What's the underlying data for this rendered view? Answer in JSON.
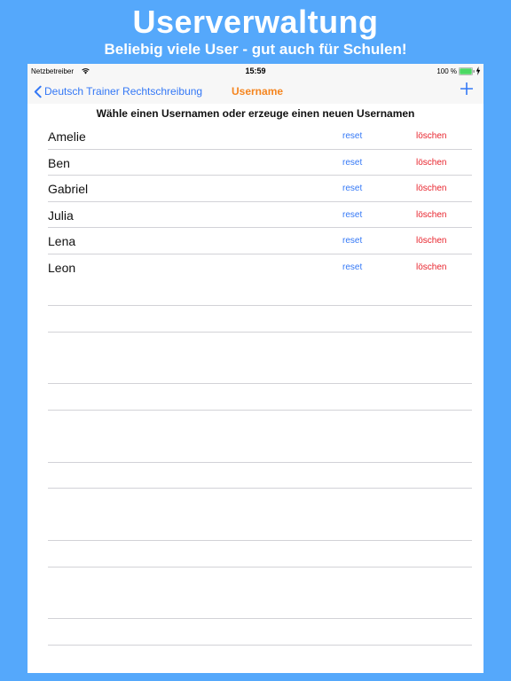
{
  "promo": {
    "title": "Userverwaltung",
    "subtitle": "Beliebig viele User - gut auch für Schulen!"
  },
  "statusbar": {
    "carrier": "Netzbetreiber",
    "time": "15:59",
    "battery": "100 %"
  },
  "navbar": {
    "back_label": "Deutsch Trainer Rechtschreibung",
    "title": "Username"
  },
  "instruction": "Wähle einen Usernamen oder erzeuge einen neuen Usernamen",
  "users": [
    {
      "name": "Amelie",
      "reset": "reset",
      "delete": "löschen"
    },
    {
      "name": "Ben",
      "reset": "reset",
      "delete": "löschen"
    },
    {
      "name": "Gabriel",
      "reset": "reset",
      "delete": "löschen"
    },
    {
      "name": "Julia",
      "reset": "reset",
      "delete": "löschen"
    },
    {
      "name": "Lena",
      "reset": "reset",
      "delete": "löschen"
    },
    {
      "name": "Leon",
      "reset": "reset",
      "delete": "löschen"
    }
  ],
  "colors": {
    "background": "#55a8fb",
    "tint": "#3478f6",
    "nav_title": "#f5851f",
    "delete": "#e8242d"
  },
  "icons": [
    "wifi-icon",
    "battery-icon",
    "charging-icon",
    "back-chevron-icon",
    "plus-icon"
  ]
}
